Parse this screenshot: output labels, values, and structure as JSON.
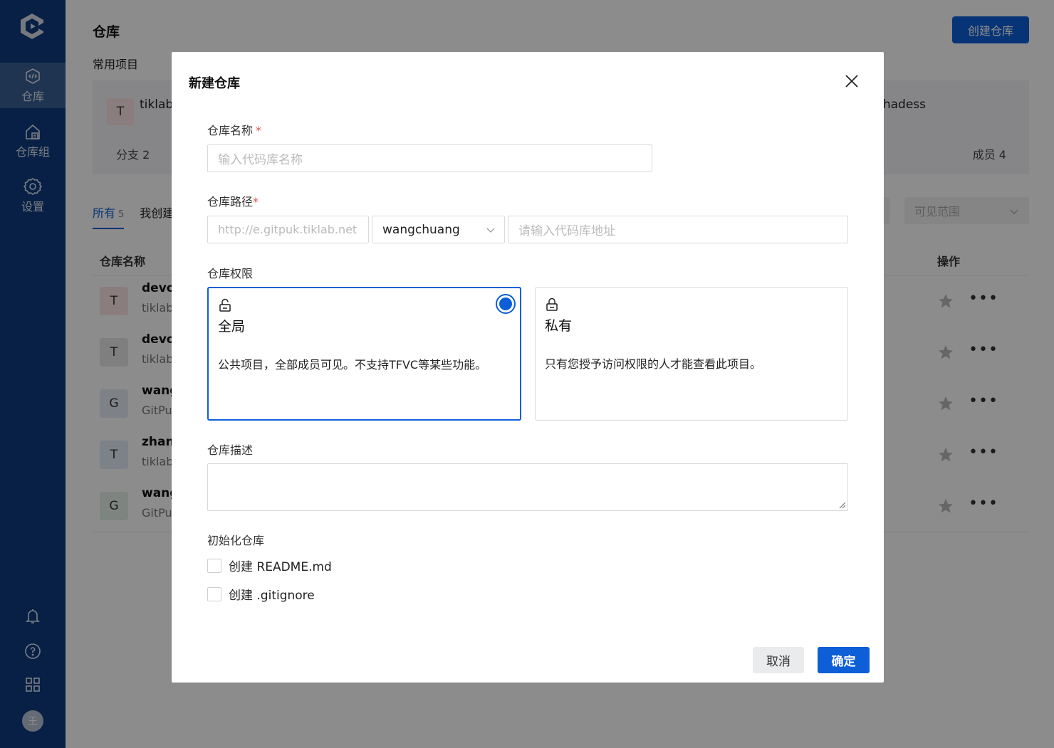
{
  "sidebar": {
    "items": [
      {
        "label": "仓库",
        "icon": "repo-code-icon"
      },
      {
        "label": "仓库组",
        "icon": "repo-group-icon"
      },
      {
        "label": "设置",
        "icon": "gear-icon"
      }
    ],
    "bottom_icons": [
      "bell-icon",
      "help-icon",
      "apps-grid-icon"
    ],
    "avatar_letter": "王"
  },
  "header": {
    "title": "仓库",
    "create_button": "创建仓库"
  },
  "recent": {
    "label": "常用项目",
    "card": {
      "avatar": "T",
      "name": "tiklab-",
      "right_name": "-hadess",
      "branch_label": "分支 2",
      "members_label": "成员 4"
    }
  },
  "tabs": [
    {
      "label": "所有",
      "count": "5"
    },
    {
      "label": "我创建",
      "count": ""
    }
  ],
  "filters": {
    "visibility_placeholder": "可见范围"
  },
  "table": {
    "col_name": "仓库名称",
    "col_actions": "操作",
    "rows": [
      {
        "avatar": "T",
        "title": "devo",
        "sub": "tiklab",
        "avatar_color": "#fbe3e3"
      },
      {
        "avatar": "T",
        "title": "devo",
        "sub": "tiklab",
        "avatar_color": "#e8e8e8"
      },
      {
        "avatar": "G",
        "title": "wang",
        "sub": "GitPu",
        "avatar_color": "#e6ecf5"
      },
      {
        "avatar": "T",
        "title": "zhang",
        "sub": "tiklab",
        "avatar_color": "#e3ebf7"
      },
      {
        "avatar": "G",
        "title": "wang",
        "sub": "GitPu",
        "avatar_color": "#e6f0ea"
      }
    ]
  },
  "modal": {
    "title": "新建仓库",
    "name_label": "仓库名称",
    "name_placeholder": "输入代码库名称",
    "path_label": "仓库路径",
    "path_prefix_placeholder": "http://e.gitpuk.tiklab.net",
    "path_owner_value": "wangchuang",
    "path_placeholder": "请输入代码库地址",
    "permission_label": "仓库权限",
    "permissions": [
      {
        "title": "全局",
        "desc": "公共项目，全部成员可见。不支持TFVC等某些功能。",
        "selected": true,
        "icon": "unlock-icon"
      },
      {
        "title": "私有",
        "desc": "只有您授予访问权限的人才能查看此项目。",
        "selected": false,
        "icon": "lock-icon"
      }
    ],
    "desc_label": "仓库描述",
    "init_label": "初始化仓库",
    "init_options": [
      "创建 README.md",
      "创建 .gitignore"
    ],
    "cancel": "取消",
    "confirm": "确定"
  },
  "colors": {
    "sidebar": "#0f3b7f",
    "primary": "#0d5fd8",
    "required": "#e34c4c"
  }
}
